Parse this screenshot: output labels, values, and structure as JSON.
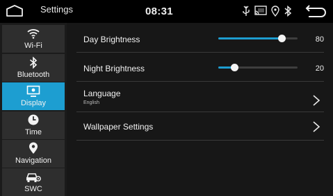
{
  "statusbar": {
    "title": "Settings",
    "time": "08:31",
    "icons": [
      "usb-icon",
      "screen-mirror-icon",
      "location-icon",
      "bluetooth-icon"
    ]
  },
  "sidebar": {
    "items": [
      {
        "label": "Wi-Fi",
        "icon": "wifi-icon",
        "active": false
      },
      {
        "label": "Bluetooth",
        "icon": "bluetooth-icon",
        "active": false
      },
      {
        "label": "Display",
        "icon": "display-icon",
        "active": true
      },
      {
        "label": "Time",
        "icon": "clock-icon",
        "active": false
      },
      {
        "label": "Navigation",
        "icon": "location-pin-icon",
        "active": false
      },
      {
        "label": "SWC",
        "icon": "steering-wheel-control-icon",
        "active": false
      }
    ]
  },
  "main": {
    "day_brightness": {
      "label": "Day Brightness",
      "value": "80",
      "level": 80,
      "max": 100
    },
    "night_brightness": {
      "label": "Night Brightness",
      "value": "20",
      "level": 20,
      "max": 100
    },
    "language": {
      "label": "Language",
      "value": "English"
    },
    "wallpaper": {
      "label": "Wallpaper Settings"
    }
  },
  "colors": {
    "accent": "#1d9ed1",
    "sidebar_bg": "#1b1b1b",
    "main_bg": "#171717"
  }
}
